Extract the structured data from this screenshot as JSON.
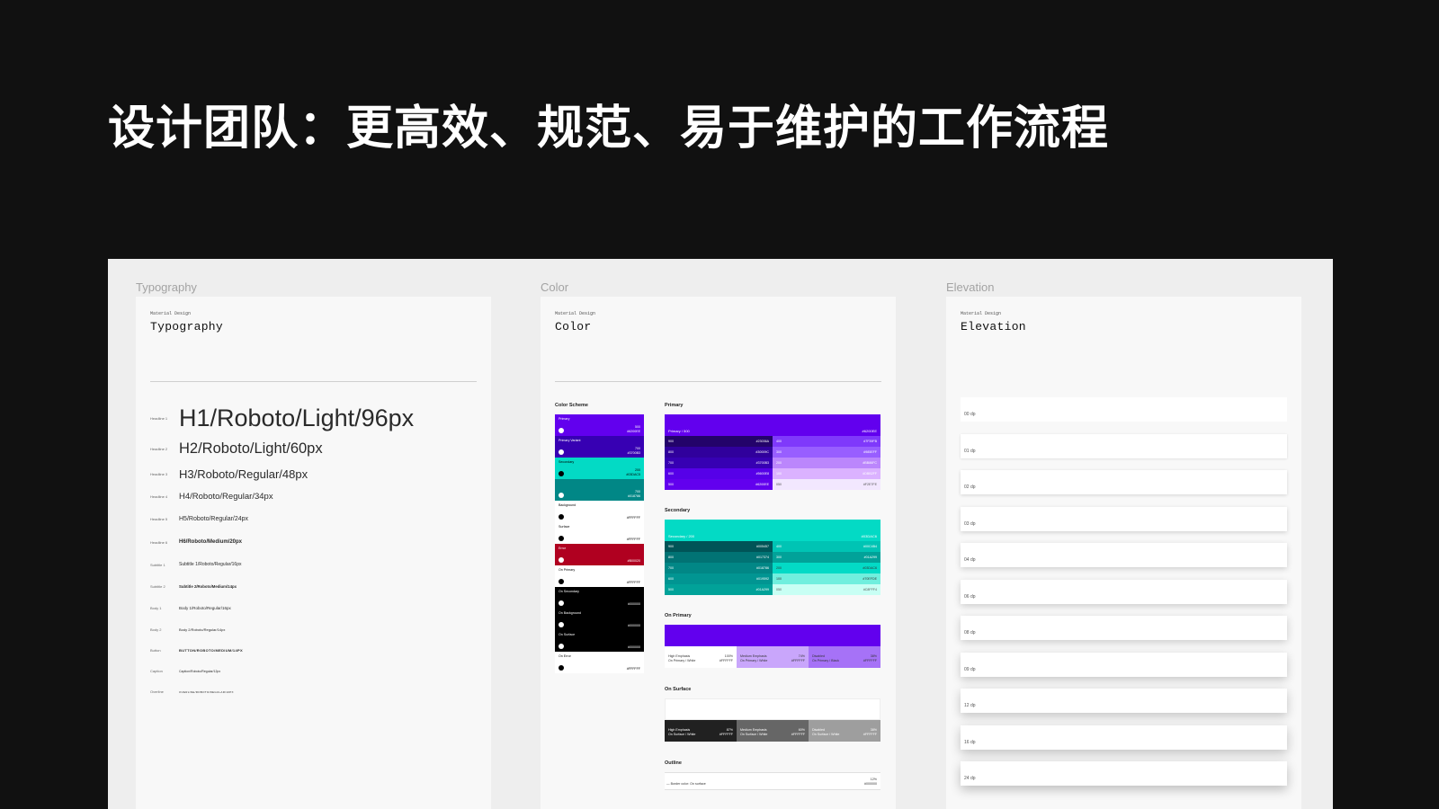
{
  "slide_title": "设计团队：更高效、规范、易于维护的工作流程",
  "frames": {
    "typography": {
      "label": "Typography",
      "meta": "Material Design",
      "heading": "Typography",
      "rows": [
        {
          "label": "Headline 1",
          "sample": "H1/Roboto/Light/96px"
        },
        {
          "label": "Headline 2",
          "sample": "H2/Roboto/Light/60px"
        },
        {
          "label": "Headline 3",
          "sample": "H3/Roboto/Regular/48px"
        },
        {
          "label": "Headline 4",
          "sample": "H4/Roboto/Regular/34px"
        },
        {
          "label": "Headline 5",
          "sample": "H5/Roboto/Regular/24px"
        },
        {
          "label": "Headline 6",
          "sample": "H6/Roboto/Medium/20px"
        },
        {
          "label": "Subtitle 1",
          "sample": "Subtitle 1/Roboto/Regular/16px"
        },
        {
          "label": "Subtitle 2",
          "sample": "Subtitle 2/Roboto/Medium/14px"
        },
        {
          "label": "Body 1",
          "sample": "Body 1/Roboto/Regular/16px"
        },
        {
          "label": "Body 2",
          "sample": "Body 2/Roboto/Regular/14px"
        },
        {
          "label": "Button",
          "sample": "BUTTON/ROBOTO/MEDIUM/14PX"
        },
        {
          "label": "Caption",
          "sample": "Caption/Roboto/Regular/12px"
        },
        {
          "label": "Overline",
          "sample": "OVERLINE/ROBOTO/REGULAR/10PX"
        }
      ]
    },
    "color": {
      "label": "Color",
      "meta": "Material Design",
      "heading": "Color",
      "scheme_title": "Color Scheme",
      "scheme": [
        {
          "name": "Primary",
          "num": "500",
          "hex": "#6200EE",
          "bg": "#6200ee",
          "fg": "#ffffff",
          "dot": "#ffffff"
        },
        {
          "name": "Primary Variant",
          "num": "700",
          "hex": "#3700B3",
          "bg": "#3700b3",
          "fg": "#ffffff",
          "dot": "#ffffff"
        },
        {
          "name": "Secondary",
          "num": "200",
          "hex": "#03DAC5",
          "bg": "#03dac5",
          "fg": "#000000",
          "dot": "#000000"
        },
        {
          "name": "",
          "num": "700",
          "hex": "#018786",
          "bg": "#018786",
          "fg": "#ffffff",
          "dot": "#ffffff"
        },
        {
          "name": "Background",
          "num": "",
          "hex": "#FFFFFF",
          "bg": "#ffffff",
          "fg": "#000000",
          "dot": "#000000"
        },
        {
          "name": "Surface",
          "num": "",
          "hex": "#FFFFFF",
          "bg": "#ffffff",
          "fg": "#000000",
          "dot": "#000000"
        },
        {
          "name": "Error",
          "num": "",
          "hex": "#B00020",
          "bg": "#b00020",
          "fg": "#ffffff",
          "dot": "#ffffff"
        },
        {
          "name": "On Primary",
          "num": "",
          "hex": "#FFFFFF",
          "bg": "#ffffff",
          "fg": "#000000",
          "dot": "#000000"
        },
        {
          "name": "On Secondary",
          "num": "",
          "hex": "#000000",
          "bg": "#000000",
          "fg": "#ffffff",
          "dot": "#ffffff"
        },
        {
          "name": "On Background",
          "num": "",
          "hex": "#000000",
          "bg": "#000000",
          "fg": "#ffffff",
          "dot": "#ffffff"
        },
        {
          "name": "On Surface",
          "num": "",
          "hex": "#000000",
          "bg": "#000000",
          "fg": "#ffffff",
          "dot": "#ffffff"
        },
        {
          "name": "On Error",
          "num": "",
          "hex": "#FFFFFF",
          "bg": "#ffffff",
          "fg": "#000000",
          "dot": "#000000"
        }
      ],
      "primary": {
        "title": "Primary",
        "head": {
          "label": "Primary / 500",
          "hex": "#6200EE",
          "bg": "#6200ee"
        },
        "cells": [
          {
            "n": "900",
            "hex": "#23036A",
            "bg": "#23036a",
            "fg": "#ffffff"
          },
          {
            "n": "400",
            "hex": "#7F39FB",
            "bg": "#7f39fb",
            "fg": "#ffffff"
          },
          {
            "n": "800",
            "hex": "#30009C",
            "bg": "#30009c",
            "fg": "#ffffff"
          },
          {
            "n": "300",
            "hex": "#985EFF",
            "bg": "#985eff",
            "fg": "#ffffff"
          },
          {
            "n": "700",
            "hex": "#3700B3",
            "bg": "#3700b3",
            "fg": "#ffffff"
          },
          {
            "n": "200",
            "hex": "#BB86FC",
            "bg": "#bb86fc",
            "fg": "#ffffff"
          },
          {
            "n": "600",
            "hex": "#5600E8",
            "bg": "#5600e8",
            "fg": "#ffffff"
          },
          {
            "n": "100",
            "hex": "#DBB2FF",
            "bg": "#dbb2ff",
            "fg": "#ffffff"
          },
          {
            "n": "500",
            "hex": "#6200EE",
            "bg": "#6200ee",
            "fg": "#ffffff"
          },
          {
            "n": "050",
            "hex": "#F2E7FE",
            "bg": "#f2e7fe",
            "fg": "#555555"
          }
        ]
      },
      "secondary": {
        "title": "Secondary",
        "head": {
          "label": "Secondary / 200",
          "hex": "#03DAC6",
          "bg": "#03dac5"
        },
        "cells": [
          {
            "n": "900",
            "hex": "#005457",
            "bg": "#005457",
            "fg": "#ffffff"
          },
          {
            "n": "400",
            "hex": "#00C4B4",
            "bg": "#00c4b4",
            "fg": "#ffffff"
          },
          {
            "n": "800",
            "hex": "#017374",
            "bg": "#017374",
            "fg": "#ffffff"
          },
          {
            "n": "300",
            "hex": "#01A299",
            "bg": "#01a299",
            "fg": "#ffffff"
          },
          {
            "n": "700",
            "hex": "#018786",
            "bg": "#018786",
            "fg": "#ffffff"
          },
          {
            "n": "200",
            "hex": "#03DAC6",
            "bg": "#03dac6",
            "fg": "#333333"
          },
          {
            "n": "600",
            "hex": "#019592",
            "bg": "#019592",
            "fg": "#ffffff"
          },
          {
            "n": "100",
            "hex": "#70EFDE",
            "bg": "#70efde",
            "fg": "#333333"
          },
          {
            "n": "500",
            "hex": "#01A299",
            "bg": "#01a299",
            "fg": "#ffffff"
          },
          {
            "n": "050",
            "hex": "#C8FFF4",
            "bg": "#c8fff4",
            "fg": "#555555"
          }
        ]
      },
      "on_primary": {
        "title": "On Primary",
        "bg": "#6200ee",
        "items": [
          {
            "a": "High Emphasis",
            "b": "On Primary / White",
            "c": "100%",
            "d": "#FFFFFF",
            "bg": "#ffffff",
            "fg": "#333333"
          },
          {
            "a": "Medium Emphasis",
            "b": "On Primary / White",
            "c": "74%",
            "d": "#FFFFFF",
            "bg": "#c9a6fb",
            "fg": "#333333"
          },
          {
            "a": "Disabled",
            "b": "On Primary / Black",
            "c": "38%",
            "d": "#FFFFFF",
            "bg": "#a672f7",
            "fg": "#333333"
          }
        ]
      },
      "on_surface": {
        "title": "On Surface",
        "bg": "#ffffff",
        "items": [
          {
            "a": "High Emphasis",
            "b": "On Surface / White",
            "c": "87%",
            "d": "#FFFFFF",
            "bg": "#212121",
            "fg": "#ffffff"
          },
          {
            "a": "Medium Emphasis",
            "b": "On Surface / White",
            "c": "60%",
            "d": "#FFFFFF",
            "bg": "#666666",
            "fg": "#ffffff"
          },
          {
            "a": "Disabled",
            "b": "On Surface / White",
            "c": "38%",
            "d": "#FFFFFF",
            "bg": "#9e9e9e",
            "fg": "#ffffff"
          }
        ]
      },
      "outline": {
        "title": "Outline",
        "label": "— Border color: On surface",
        "pct": "12%",
        "hex": "#000000"
      }
    },
    "elevation": {
      "label": "Elevation",
      "meta": "Material Design",
      "heading": "Elevation",
      "cards": [
        "00 dp",
        "01 dp",
        "02 dp",
        "03 dp",
        "04 dp",
        "06 dp",
        "08 dp",
        "09 dp",
        "12 dp",
        "16 dp",
        "24 dp"
      ]
    }
  }
}
